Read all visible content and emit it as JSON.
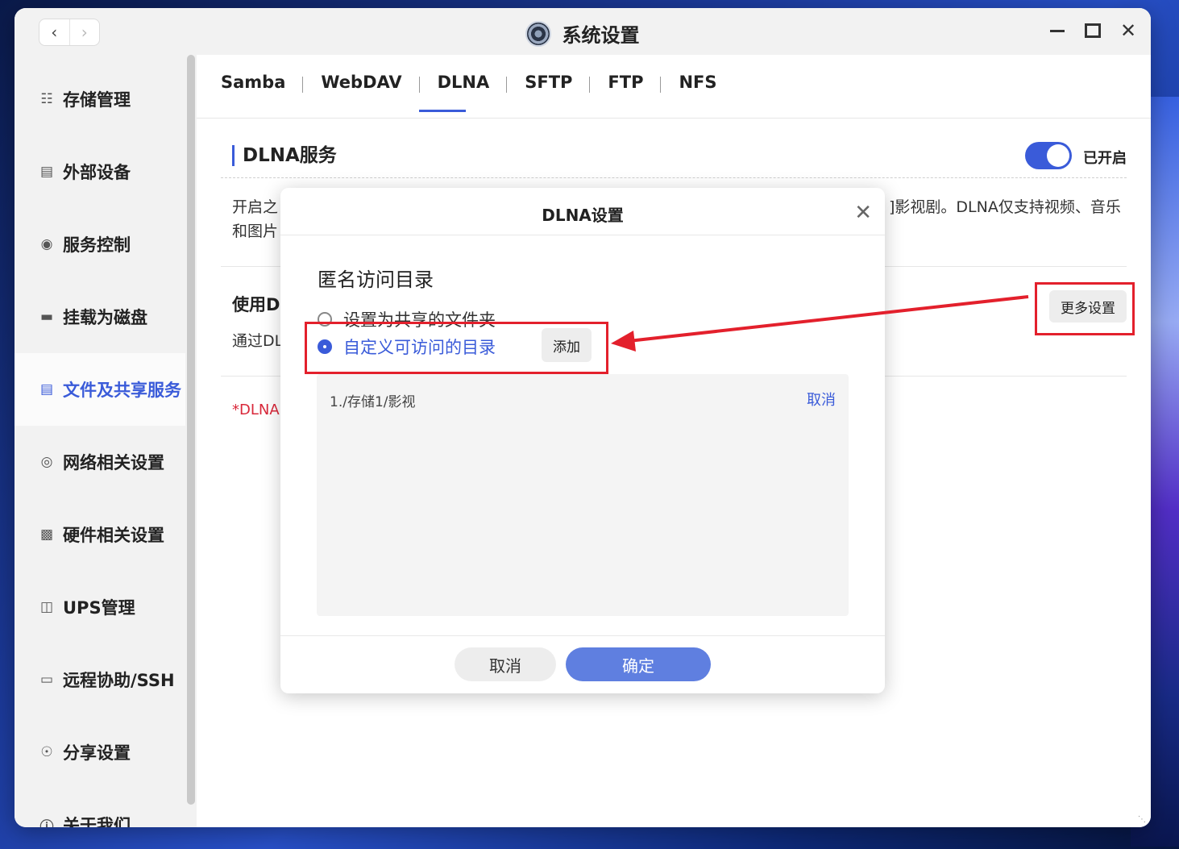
{
  "window": {
    "title": "系统设置"
  },
  "sidebar": {
    "items": [
      {
        "label": "存储管理",
        "icon": "database-icon"
      },
      {
        "label": "外部设备",
        "icon": "external-device-icon"
      },
      {
        "label": "服务控制",
        "icon": "toggle-icon"
      },
      {
        "label": "挂载为磁盘",
        "icon": "drive-icon"
      },
      {
        "label": "文件及共享服务",
        "icon": "file-share-icon",
        "active": true
      },
      {
        "label": "网络相关设置",
        "icon": "globe-icon"
      },
      {
        "label": "硬件相关设置",
        "icon": "grid-icon"
      },
      {
        "label": "UPS管理",
        "icon": "ups-icon"
      },
      {
        "label": "远程协助/SSH",
        "icon": "remote-icon"
      },
      {
        "label": "分享设置",
        "icon": "share-icon"
      },
      {
        "label": "关于我们",
        "icon": "info-icon"
      }
    ]
  },
  "tabs": [
    {
      "label": "Samba"
    },
    {
      "label": "WebDAV"
    },
    {
      "label": "DLNA",
      "active": true
    },
    {
      "label": "SFTP"
    },
    {
      "label": "FTP"
    },
    {
      "label": "NFS"
    }
  ],
  "section": {
    "title": "DLNA服务",
    "toggle_label": "已开启",
    "toggle_on": true,
    "desc_line1_start": "开启之",
    "desc_line1_end": "]影视剧。DLNA仅支持视频、音乐",
    "desc_line2": "和图片",
    "use_title": "使用D",
    "use_desc": "通过DL",
    "note": "*DLNA",
    "more_settings": "更多设置"
  },
  "modal": {
    "title": "DLNA设置",
    "label": "匿名访问目录",
    "option_shared": "设置为共享的文件夹",
    "option_custom": "自定义可访问的目录",
    "add_button": "添加",
    "dirs": [
      {
        "path": "1./存储1/影视",
        "cancel": "取消"
      }
    ],
    "cancel_button": "取消",
    "ok_button": "确定"
  },
  "colors": {
    "accent": "#3a5bd9",
    "annotation_red": "#e3202c",
    "note_red": "#d9283a"
  }
}
